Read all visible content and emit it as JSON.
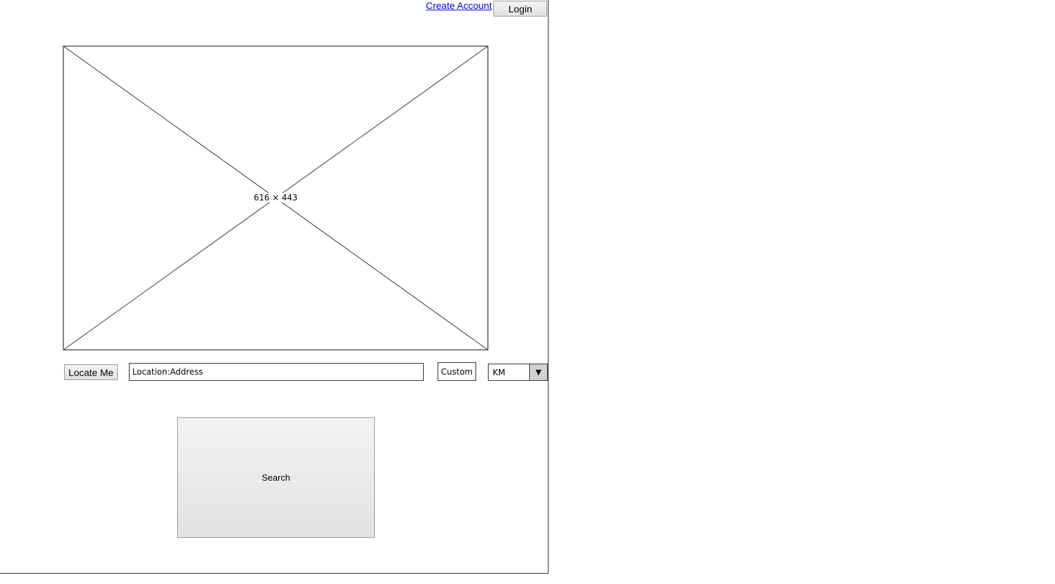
{
  "header": {
    "create_account_label": "Create Account",
    "login_label": "Login"
  },
  "image_placeholder": {
    "caption": "616 × 443"
  },
  "controls": {
    "locate_me_label": "Locate Me",
    "location_value": "Location:Address",
    "custom_value": "Custom",
    "unit_selected": "KM",
    "arrow_icon": "chevron-down-icon"
  },
  "search": {
    "label": "Search"
  }
}
